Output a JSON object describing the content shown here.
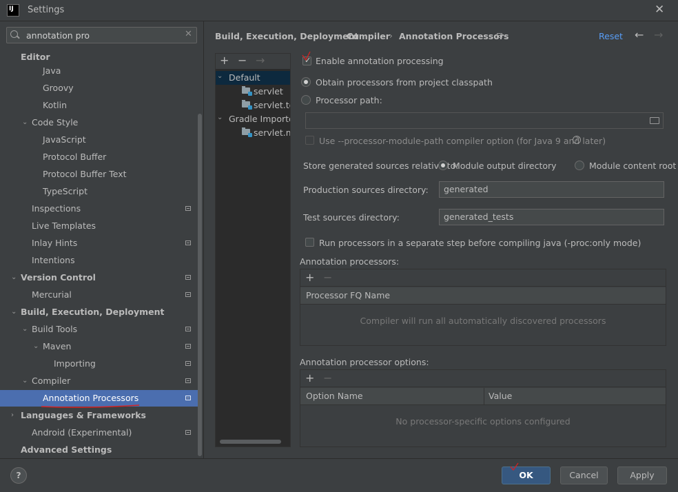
{
  "window": {
    "title": "Settings",
    "logo_text": "IJ"
  },
  "search": {
    "value": "annotation pro"
  },
  "sidebar": {
    "items": [
      {
        "label": "Editor"
      },
      {
        "label": "Java"
      },
      {
        "label": "Groovy"
      },
      {
        "label": "Kotlin"
      },
      {
        "label": "Code Style"
      },
      {
        "label": "JavaScript"
      },
      {
        "label": "Protocol Buffer"
      },
      {
        "label": "Protocol Buffer Text"
      },
      {
        "label": "TypeScript"
      },
      {
        "label": "Inspections"
      },
      {
        "label": "Live Templates"
      },
      {
        "label": "Inlay Hints"
      },
      {
        "label": "Intentions"
      },
      {
        "label": "Version Control"
      },
      {
        "label": "Mercurial"
      },
      {
        "label": "Build, Execution, Deployment"
      },
      {
        "label": "Build Tools"
      },
      {
        "label": "Maven"
      },
      {
        "label": "Importing"
      },
      {
        "label": "Compiler"
      },
      {
        "label": "Annotation Processors"
      },
      {
        "label": "Languages & Frameworks"
      },
      {
        "label": "Android (Experimental)"
      },
      {
        "label": "Advanced Settings"
      }
    ]
  },
  "breadcrumb": {
    "items": [
      "Build, Execution, Deployment",
      "Compiler",
      "Annotation Processors"
    ],
    "reset": "Reset"
  },
  "profiles": {
    "items": [
      "Default",
      "servlet",
      "servlet.test",
      "Gradle Imported",
      "servlet.main"
    ]
  },
  "options": {
    "enable_label": "Enable annotation processing",
    "obtain_label": "Obtain processors from project classpath",
    "processor_path_label": "Processor path:",
    "processor_path_value": "",
    "module_path_label": "Use --processor-module-path compiler option (for Java 9 and later)",
    "store_label": "Store generated sources relative to:",
    "module_output_label": "Module output directory",
    "module_content_label": "Module content root",
    "production_label": "Production sources directory:",
    "production_value": "generated",
    "test_label": "Test sources directory:",
    "test_value": "generated_tests",
    "run_separate_label": "Run processors in a separate step before compiling java (-proc:only mode)"
  },
  "processors_table": {
    "title": "Annotation processors:",
    "column": "Processor FQ Name",
    "empty": "Compiler will run all automatically discovered processors"
  },
  "options_table": {
    "title": "Annotation processor options:",
    "columns": [
      "Option Name",
      "Value"
    ],
    "empty": "No processor-specific options configured"
  },
  "footer": {
    "help": "?",
    "ok": "OK",
    "cancel": "Cancel",
    "apply": "Apply"
  }
}
